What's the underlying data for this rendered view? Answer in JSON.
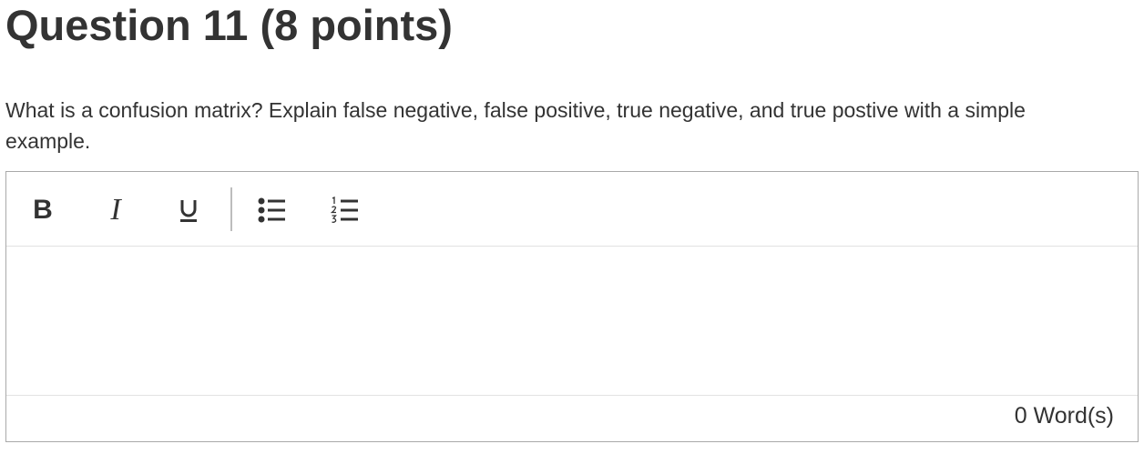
{
  "question": {
    "title": "Question 11 (8 points)",
    "prompt": "What is a confusion matrix? Explain false negative, false positive, true negative, and true postive with a simple example."
  },
  "editor": {
    "toolbar": {
      "bold_label": "B",
      "italic_label": "I",
      "buttons": [
        "bold-icon",
        "italic-icon",
        "underline-icon",
        "bulleted-list-icon",
        "numbered-list-icon"
      ]
    },
    "content": "",
    "word_count": "0 Word(s)"
  }
}
